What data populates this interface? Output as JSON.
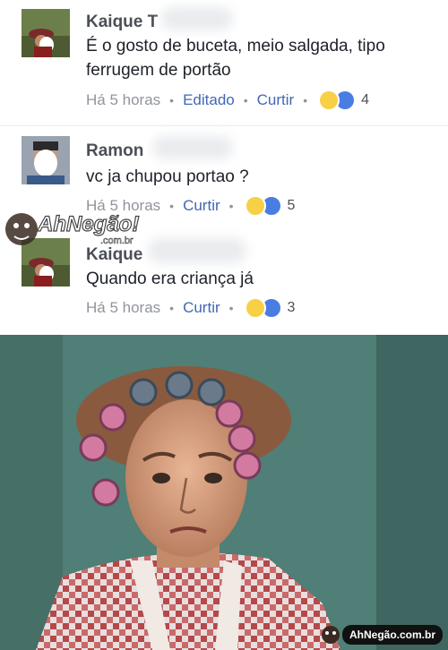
{
  "comments": [
    {
      "author": "Kaique T",
      "text": "É o gosto de buceta, meio salgada, tipo ferrugem de portão",
      "time": "Há 5 horas",
      "edited": "Editado",
      "action": "Curtir",
      "reaction_count": "4"
    },
    {
      "author": "Ramon",
      "text": "vc ja chupou portao ?",
      "time": "Há 5 horas",
      "action": "Curtir",
      "reaction_count": "5"
    },
    {
      "author": "Kaique",
      "text": "Quando era criança já",
      "time": "Há 5 horas",
      "action": "Curtir",
      "reaction_count": "3"
    }
  ],
  "watermark": {
    "top_logo": "AhNegão!",
    "top_sub": ".com.br",
    "bottom": "AhNegão.com.br"
  },
  "icons": {
    "haha": "haha-reaction-icon",
    "like": "like-reaction-icon"
  },
  "colors": {
    "link": "#4267b2",
    "meta": "#90949c",
    "text": "#1d2129",
    "name": "#4b4f56"
  }
}
